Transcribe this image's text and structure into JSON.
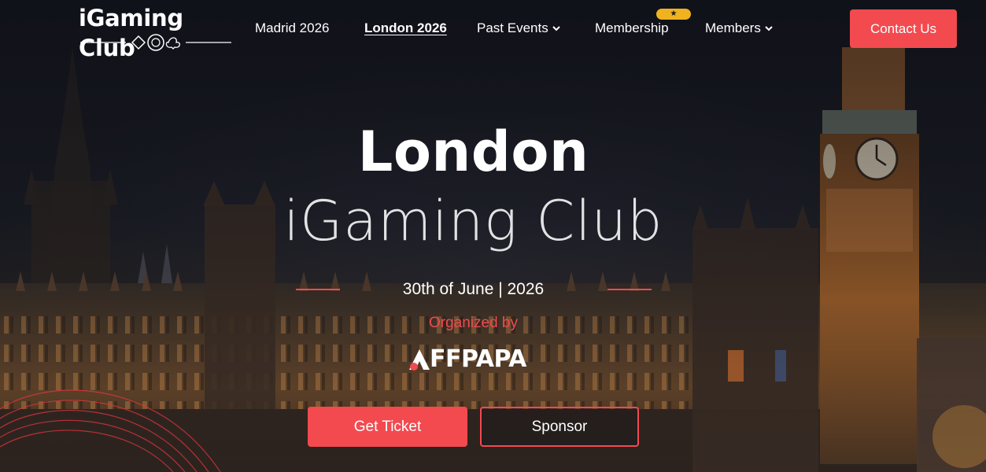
{
  "brand": {
    "logo_text": "iGaming Club",
    "accent_color": "#f24a4f",
    "badge_color": "#f0b21e"
  },
  "nav": {
    "items": [
      {
        "label": "Madrid 2026",
        "active": false,
        "dropdown": false
      },
      {
        "label": "London 2026",
        "active": true,
        "dropdown": false
      },
      {
        "label": "Past Events",
        "active": false,
        "dropdown": true
      },
      {
        "label": "Membership",
        "active": false,
        "dropdown": false,
        "badge_icon": "star-icon"
      },
      {
        "label": "Members",
        "active": false,
        "dropdown": true
      }
    ],
    "badge_glyph": "★",
    "contact_label": "Contact Us"
  },
  "hero": {
    "title_line1": "London",
    "title_line2": "iGaming Club",
    "date": "30th of June | 2026",
    "organized_by": "Organized by",
    "organizer_logo_text": "FFPAPA",
    "primary_cta": "Get Ticket",
    "secondary_cta": "Sponsor"
  }
}
